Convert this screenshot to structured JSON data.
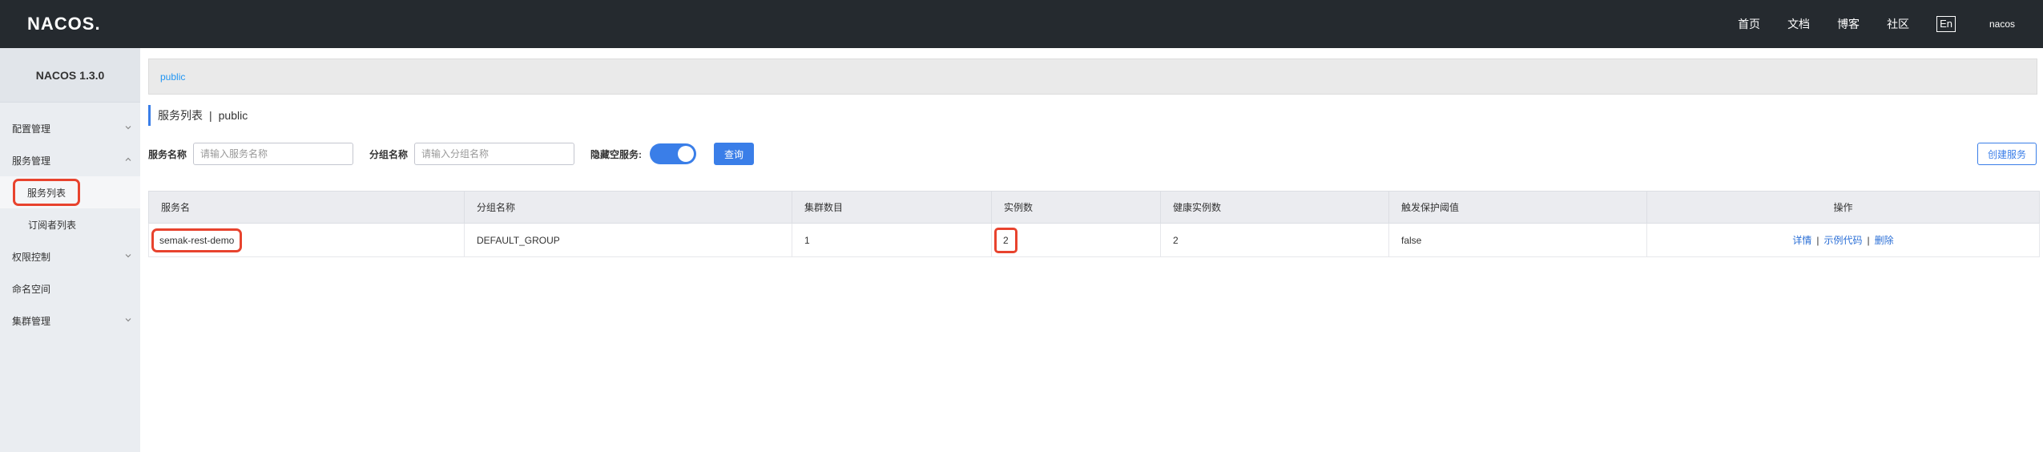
{
  "header": {
    "logo": "NACOS.",
    "nav": [
      "首页",
      "文档",
      "博客",
      "社区"
    ],
    "lang": "En",
    "user": "nacos"
  },
  "sidebar": {
    "version": "NACOS 1.3.0",
    "items": [
      {
        "label": "配置管理",
        "icon": "chevron-down-icon"
      },
      {
        "label": "服务管理",
        "icon": "chevron-up-icon"
      },
      {
        "label": "服务列表"
      },
      {
        "label": "订阅者列表"
      },
      {
        "label": "权限控制",
        "icon": "chevron-down-icon"
      },
      {
        "label": "命名空间"
      },
      {
        "label": "集群管理",
        "icon": "chevron-down-icon"
      }
    ]
  },
  "main": {
    "namespace": "public",
    "title": "服务列表",
    "title_sep": "|",
    "title_ns": "public",
    "filters": {
      "service_name_label": "服务名称",
      "service_name_placeholder": "请输入服务名称",
      "group_name_label": "分组名称",
      "group_name_placeholder": "请输入分组名称",
      "hide_empty_label": "隐藏空服务:",
      "hide_empty_on": true,
      "query_label": "查询",
      "create_label": "创建服务"
    },
    "table": {
      "headers": [
        "服务名",
        "分组名称",
        "集群数目",
        "实例数",
        "健康实例数",
        "触发保护阈值",
        "操作"
      ],
      "rows": [
        {
          "service": "semak-rest-demo",
          "group": "DEFAULT_GROUP",
          "clusters": "1",
          "instances": "2",
          "healthy": "2",
          "threshold": "false",
          "ops": [
            "详情",
            "示例代码",
            "删除"
          ],
          "sep": "|"
        }
      ]
    }
  },
  "colors": {
    "header_bg": "#252a2f",
    "sidebar_bg": "#eaedf1",
    "accent": "#3a7ee8",
    "highlight": "#e8432e"
  }
}
